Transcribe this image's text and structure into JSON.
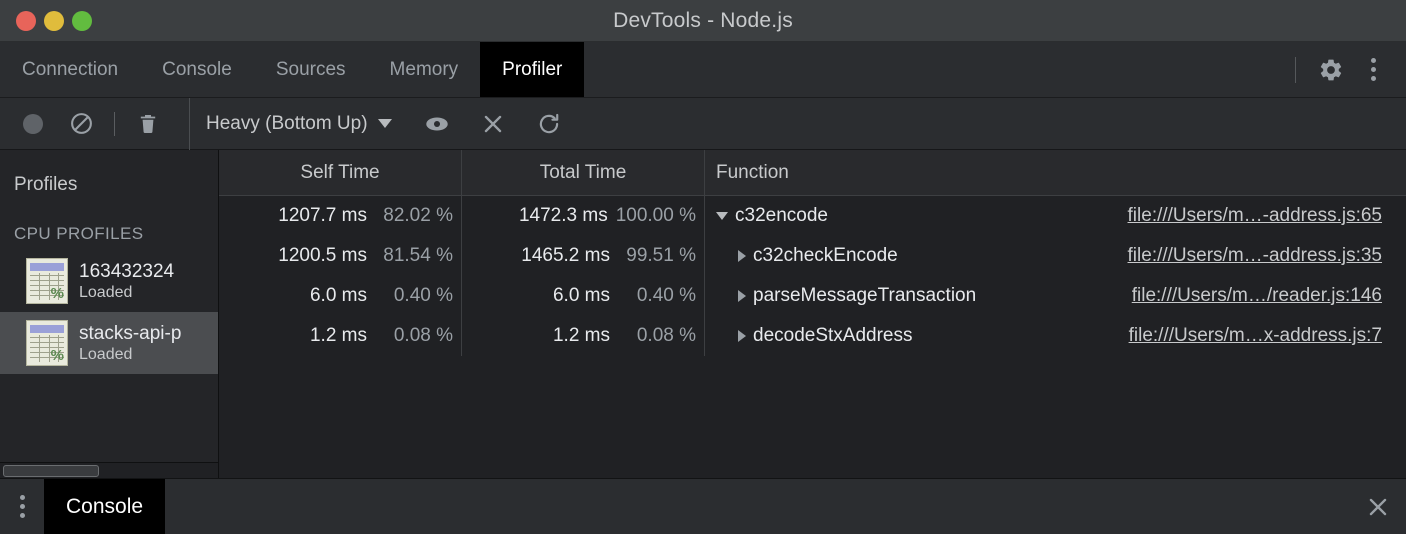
{
  "window": {
    "title": "DevTools - Node.js",
    "traffic_lights": [
      {
        "name": "close",
        "color": "#e8645a"
      },
      {
        "name": "minimize",
        "color": "#e0bc3c"
      },
      {
        "name": "maximize",
        "color": "#62bc3f"
      }
    ]
  },
  "tabs": [
    {
      "label": "Connection",
      "active": false
    },
    {
      "label": "Console",
      "active": false
    },
    {
      "label": "Sources",
      "active": false
    },
    {
      "label": "Memory",
      "active": false
    },
    {
      "label": "Profiler",
      "active": true
    }
  ],
  "tabbar_actions": {
    "settings": "gear-icon",
    "more": "more-vertical-icon"
  },
  "toolbar": {
    "record_label": "record-button",
    "clear_label": "clear-all-profiles-button",
    "delete_label": "delete-profile-button",
    "view_mode": "Heavy (Bottom Up)",
    "focus_label": "focus-selected-function-button",
    "exclude_label": "exclude-selected-function-button",
    "restore_label": "restore-all-functions-button"
  },
  "sidebar": {
    "title": "Profiles",
    "section_label": "CPU PROFILES",
    "profiles": [
      {
        "name": "163432324",
        "status": "Loaded",
        "selected": false
      },
      {
        "name": "stacks-api-p",
        "status": "Loaded",
        "selected": true
      }
    ]
  },
  "table": {
    "columns": [
      "Self Time",
      "Total Time",
      "Function"
    ],
    "rows": [
      {
        "self_ms": "1207.7 ms",
        "self_pct": "82.02 %",
        "total_ms": "1472.3 ms",
        "total_pct": "100.00 %",
        "function": "c32encode",
        "link": "file:///Users/m…-address.js:65",
        "depth": 0,
        "expanded": true
      },
      {
        "self_ms": "1200.5 ms",
        "self_pct": "81.54 %",
        "total_ms": "1465.2 ms",
        "total_pct": "99.51 %",
        "function": "c32checkEncode",
        "link": "file:///Users/m…-address.js:35",
        "depth": 1,
        "expanded": false
      },
      {
        "self_ms": "6.0 ms",
        "self_pct": "0.40 %",
        "total_ms": "6.0 ms",
        "total_pct": "0.40 %",
        "function": "parseMessageTransaction",
        "link": "file:///Users/m…/reader.js:146",
        "depth": 1,
        "expanded": false
      },
      {
        "self_ms": "1.2 ms",
        "self_pct": "0.08 %",
        "total_ms": "1.2 ms",
        "total_pct": "0.08 %",
        "function": "decodeStxAddress",
        "link": "file:///Users/m…x-address.js:7",
        "depth": 1,
        "expanded": false
      }
    ]
  },
  "drawer": {
    "menu": "more-vertical-icon",
    "tab_label": "Console",
    "close_label": "close-icon"
  },
  "colors": {
    "titlebar_bg": "#3c3f41",
    "tabbar_bg": "#2b2d30",
    "panel_bg": "#202124",
    "sidebar_bg": "#242528",
    "selected_bg": "#4b4d50",
    "active_tab_bg": "#000000",
    "text_primary": "#e8eaed",
    "text_secondary": "#9aa0a6"
  }
}
